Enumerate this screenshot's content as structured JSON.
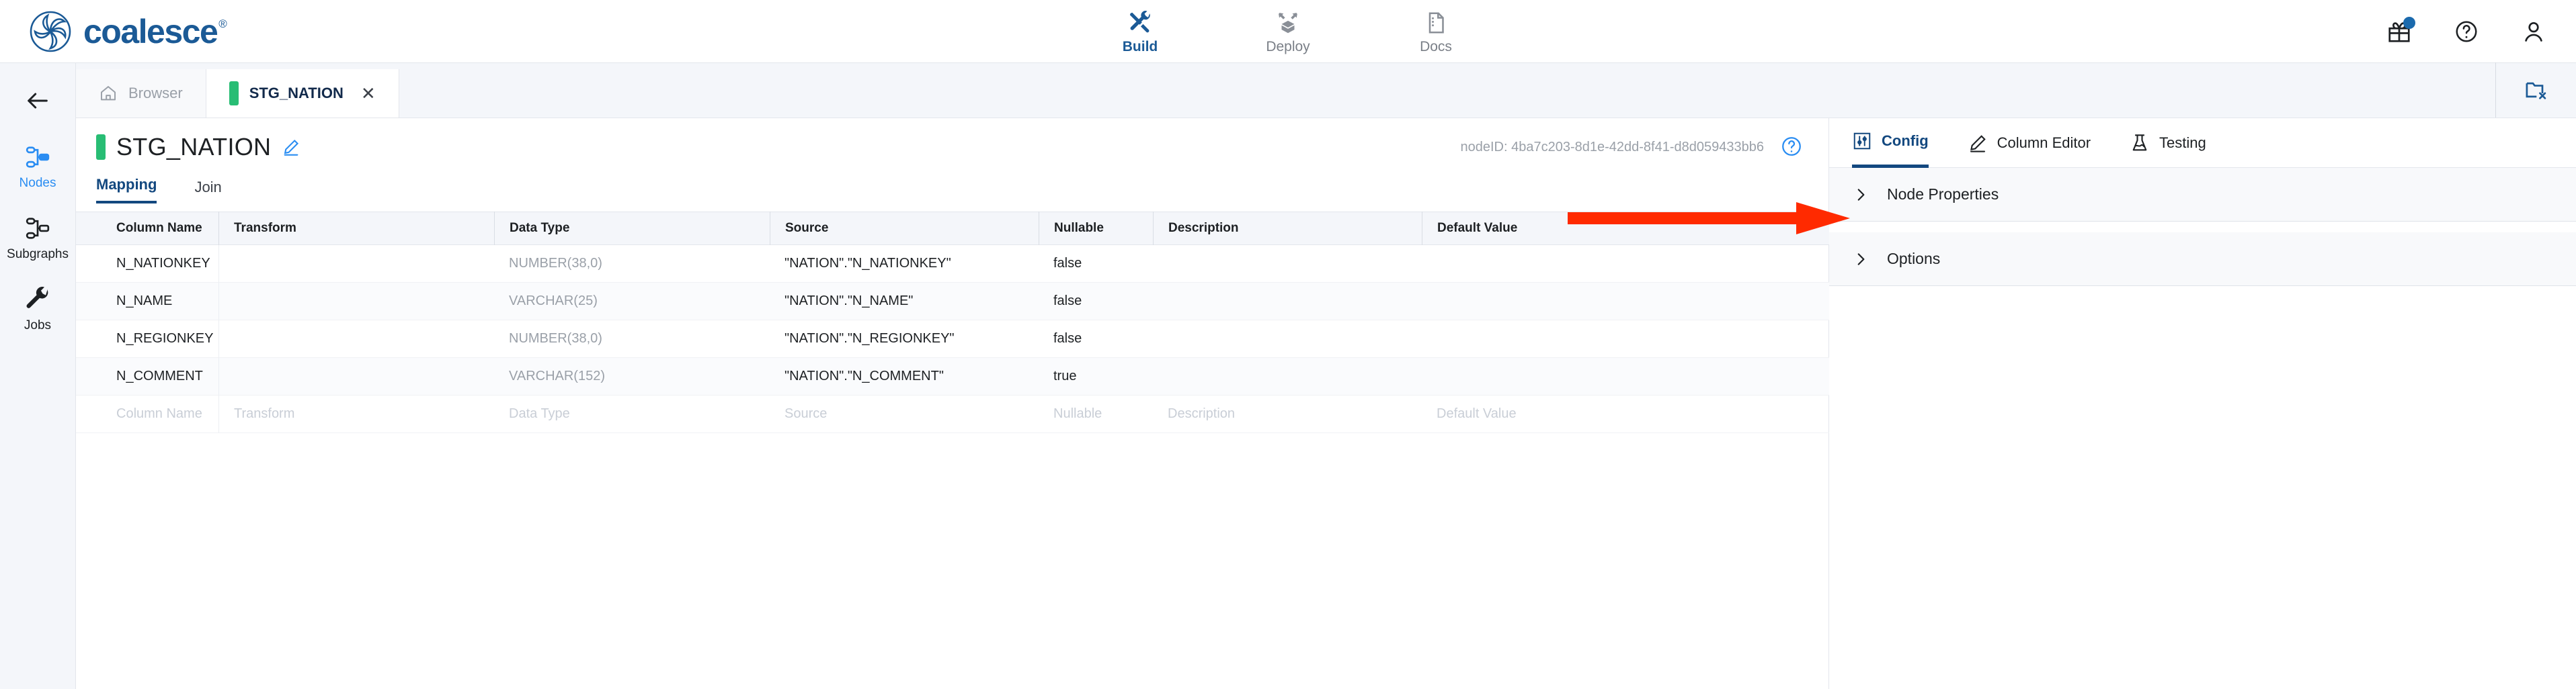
{
  "brand": {
    "name": "coalesce",
    "registered": "®",
    "logo_icon": "coalesce-pinwheel-logo"
  },
  "topnav": {
    "items": [
      {
        "label": "Build",
        "icon": "tools-icon",
        "active": true
      },
      {
        "label": "Deploy",
        "icon": "deploy-box-icon",
        "active": false
      },
      {
        "label": "Docs",
        "icon": "document-icon",
        "active": false
      }
    ]
  },
  "topright": {
    "gift": {
      "icon": "gift-icon",
      "has_notification": true
    },
    "help": {
      "icon": "help-circle-icon"
    },
    "account": {
      "icon": "user-icon"
    }
  },
  "rail": {
    "back": {
      "icon": "arrow-left-icon"
    },
    "items": [
      {
        "label": "Nodes",
        "icon": "nodes-graph-icon",
        "active": true
      },
      {
        "label": "Subgraphs",
        "icon": "subgraph-icon",
        "active": false
      },
      {
        "label": "Jobs",
        "icon": "wrench-icon",
        "active": false
      }
    ]
  },
  "tabstrip": {
    "tabs": [
      {
        "label": "Browser",
        "icon": "home-icon",
        "active": false,
        "closable": false
      },
      {
        "label": "STG_NATION",
        "icon": "green-status-bar",
        "active": true,
        "closable": true
      }
    ],
    "close_all": {
      "icon": "folder-close-icon"
    }
  },
  "editor": {
    "node_title": "STG_NATION",
    "edit_icon": "pencil-icon",
    "node_id_label": "nodeID: 4ba7c203-8d1e-42dd-8f41-d8d059433bb6",
    "help_icon": "help-circle-icon",
    "subtabs": [
      {
        "label": "Mapping",
        "active": true
      },
      {
        "label": "Join",
        "active": false
      }
    ],
    "table": {
      "headers": [
        "Column Name",
        "Transform",
        "Data Type",
        "Source",
        "Nullable",
        "Description",
        "Default Value"
      ],
      "rows": [
        {
          "column_name": "N_NATIONKEY",
          "transform": "",
          "data_type": "NUMBER(38,0)",
          "source": "\"NATION\".\"N_NATIONKEY\"",
          "nullable": "false",
          "description": "",
          "default_value": ""
        },
        {
          "column_name": "N_NAME",
          "transform": "",
          "data_type": "VARCHAR(25)",
          "source": "\"NATION\".\"N_NAME\"",
          "nullable": "false",
          "description": "",
          "default_value": ""
        },
        {
          "column_name": "N_REGIONKEY",
          "transform": "",
          "data_type": "NUMBER(38,0)",
          "source": "\"NATION\".\"N_REGIONKEY\"",
          "nullable": "false",
          "description": "",
          "default_value": ""
        },
        {
          "column_name": "N_COMMENT",
          "transform": "",
          "data_type": "VARCHAR(152)",
          "source": "\"NATION\".\"N_COMMENT\"",
          "nullable": "true",
          "description": "",
          "default_value": ""
        }
      ],
      "placeholder_row": {
        "column_name": "Column Name",
        "transform": "Transform",
        "data_type": "Data Type",
        "source": "Source",
        "nullable": "Nullable",
        "description": "Description",
        "default_value": "Default Value"
      }
    }
  },
  "right_panel": {
    "tabs": [
      {
        "label": "Config",
        "icon": "sliders-icon",
        "active": true
      },
      {
        "label": "Column Editor",
        "icon": "pencil-icon",
        "active": false
      },
      {
        "label": "Testing",
        "icon": "flask-icon",
        "active": false
      }
    ],
    "sections": [
      {
        "label": "Node Properties",
        "icon": "chevron-right-icon",
        "expanded": false
      },
      {
        "label": "Options",
        "icon": "chevron-right-icon",
        "expanded": false
      }
    ]
  },
  "annotation": {
    "type": "red-arrow-right",
    "color": "#FF2A00",
    "points_to": "Node Properties"
  },
  "colors": {
    "brand_blue": "#1b5a96",
    "accent_blue": "#13487f",
    "active_blue": "#2a8df2",
    "status_green": "#28bd74",
    "annotation_red": "#FF2A00",
    "rail_bg": "#f4f6fa"
  }
}
